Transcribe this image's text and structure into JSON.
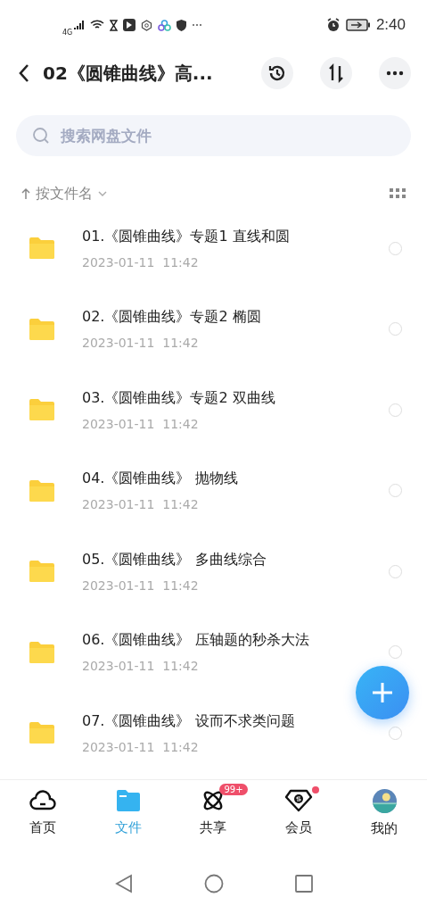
{
  "status_bar": {
    "network": "4G",
    "time": "2:40"
  },
  "header": {
    "title": "02《圆锥曲线》高..."
  },
  "search": {
    "placeholder": "搜索网盘文件"
  },
  "sort": {
    "label": "按文件名"
  },
  "files": [
    {
      "name": "01.《圆锥曲线》专题1 直线和圆",
      "date": "2023-01-11  11:42",
      "checked": false
    },
    {
      "name": "02.《圆锥曲线》专题2 椭圆",
      "date": "2023-01-11  11:42",
      "checked": false
    },
    {
      "name": "03.《圆锥曲线》专题2 双曲线",
      "date": "2023-01-11  11:42",
      "checked": false
    },
    {
      "name": "04.《圆锥曲线》 抛物线",
      "date": "2023-01-11  11:42",
      "checked": false
    },
    {
      "name": "05.《圆锥曲线》 多曲线综合",
      "date": "2023-01-11  11:42",
      "checked": false
    },
    {
      "name": "06.《圆锥曲线》 压轴题的秒杀大法",
      "date": "2023-01-11  11:42",
      "checked": false
    },
    {
      "name": "07.《圆锥曲线》 设而不求类问题",
      "date": "2023-01-11  11:42",
      "checked": false
    }
  ],
  "nav": [
    {
      "kind": "home",
      "label": "首页",
      "selected": false
    },
    {
      "kind": "files",
      "label": "文件",
      "selected": true
    },
    {
      "kind": "share",
      "label": "共享",
      "selected": false,
      "badge": "99+"
    },
    {
      "kind": "vip",
      "label": "会员",
      "selected": false,
      "dot": true
    },
    {
      "kind": "me",
      "label": "我的",
      "selected": false
    }
  ]
}
